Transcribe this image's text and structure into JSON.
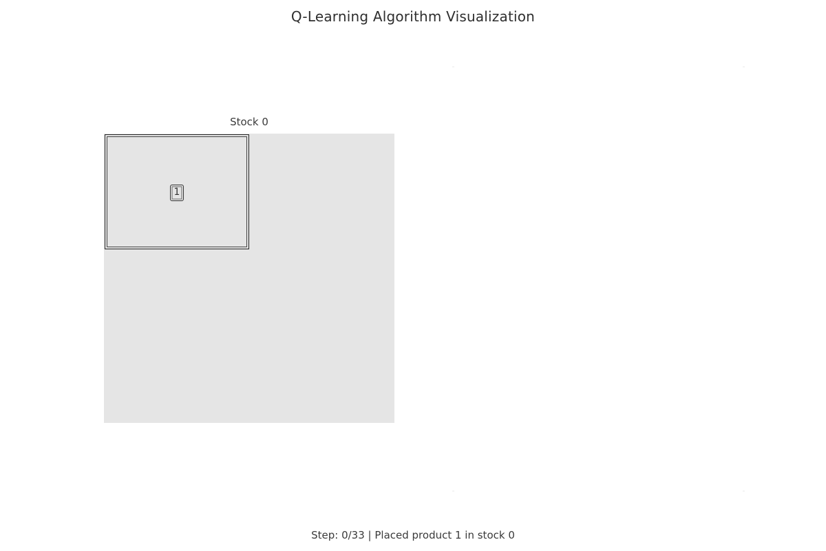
{
  "title": "Q-Learning Algorithm Visualization",
  "stocks": [
    {
      "label": "Stock 0",
      "fill_color": "#e5e5e5",
      "products": [
        {
          "label": "1"
        }
      ]
    }
  ],
  "status": "Step: 0/33 | Placed product 1 in stock 0"
}
